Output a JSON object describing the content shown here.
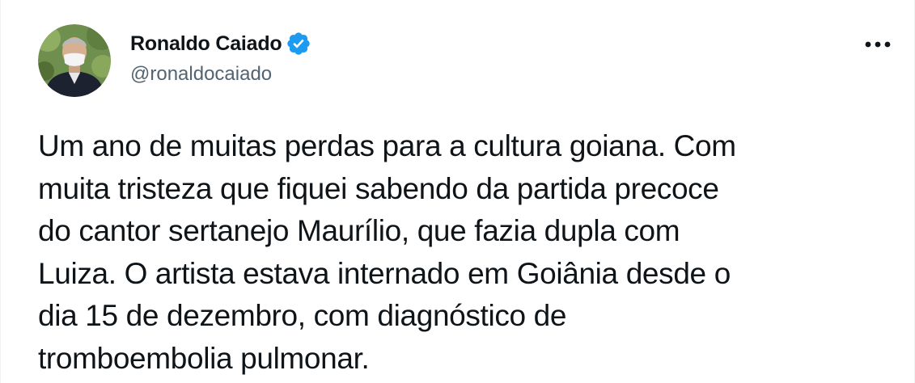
{
  "tweet": {
    "author": {
      "display_name": "Ronaldo Caiado",
      "handle": "@ronaldocaiado",
      "verified": true,
      "verified_icon": "verified-badge-icon",
      "avatar_icon": "avatar-photo"
    },
    "more_icon": "more-options-icon",
    "text_lines": [
      "Um ano de muitas perdas para a cultura goiana. Com",
      "muita tristeza que fiquei sabendo da partida precoce",
      "do cantor sertanejo Maurílio, que fazia dupla com",
      "Luiza. O artista estava internado em Goiânia desde o",
      "dia 15 de dezembro, com diagnóstico de",
      "tromboembolia pulmonar."
    ]
  },
  "colors": {
    "text_primary": "#0f1419",
    "text_secondary": "#536471",
    "verified_blue": "#1d9bf0",
    "background": "#ffffff"
  }
}
